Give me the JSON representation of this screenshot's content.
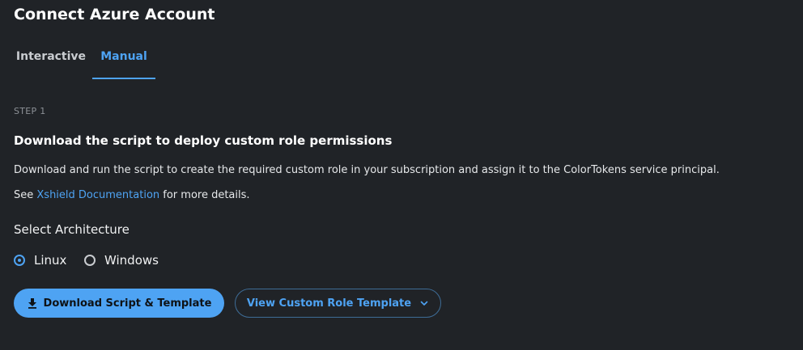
{
  "dialog": {
    "title": "Connect Azure Account"
  },
  "tabs": [
    {
      "label": "Interactive",
      "active": false
    },
    {
      "label": "Manual",
      "active": true
    }
  ],
  "step": {
    "label": "STEP 1",
    "heading": "Download the script to deploy custom role permissions",
    "description": "Download and run the script to create the required custom role in your subscription and assign it to the ColorTokens service principal.",
    "see_prefix": "See ",
    "link_text": "Xshield Documentation",
    "see_suffix": " for more details."
  },
  "architecture": {
    "label": "Select Architecture",
    "options": [
      {
        "label": "Linux",
        "selected": true
      },
      {
        "label": "Windows",
        "selected": false
      }
    ]
  },
  "buttons": {
    "download_label": "Download Script & Template",
    "download_icon": "download-icon",
    "view_label": "View Custom Role Template",
    "view_icon": "chevron-down-icon"
  },
  "colors": {
    "background": "#202327",
    "accent": "#4ea3f3",
    "text": "#ffffff",
    "muted": "#8c9096"
  }
}
